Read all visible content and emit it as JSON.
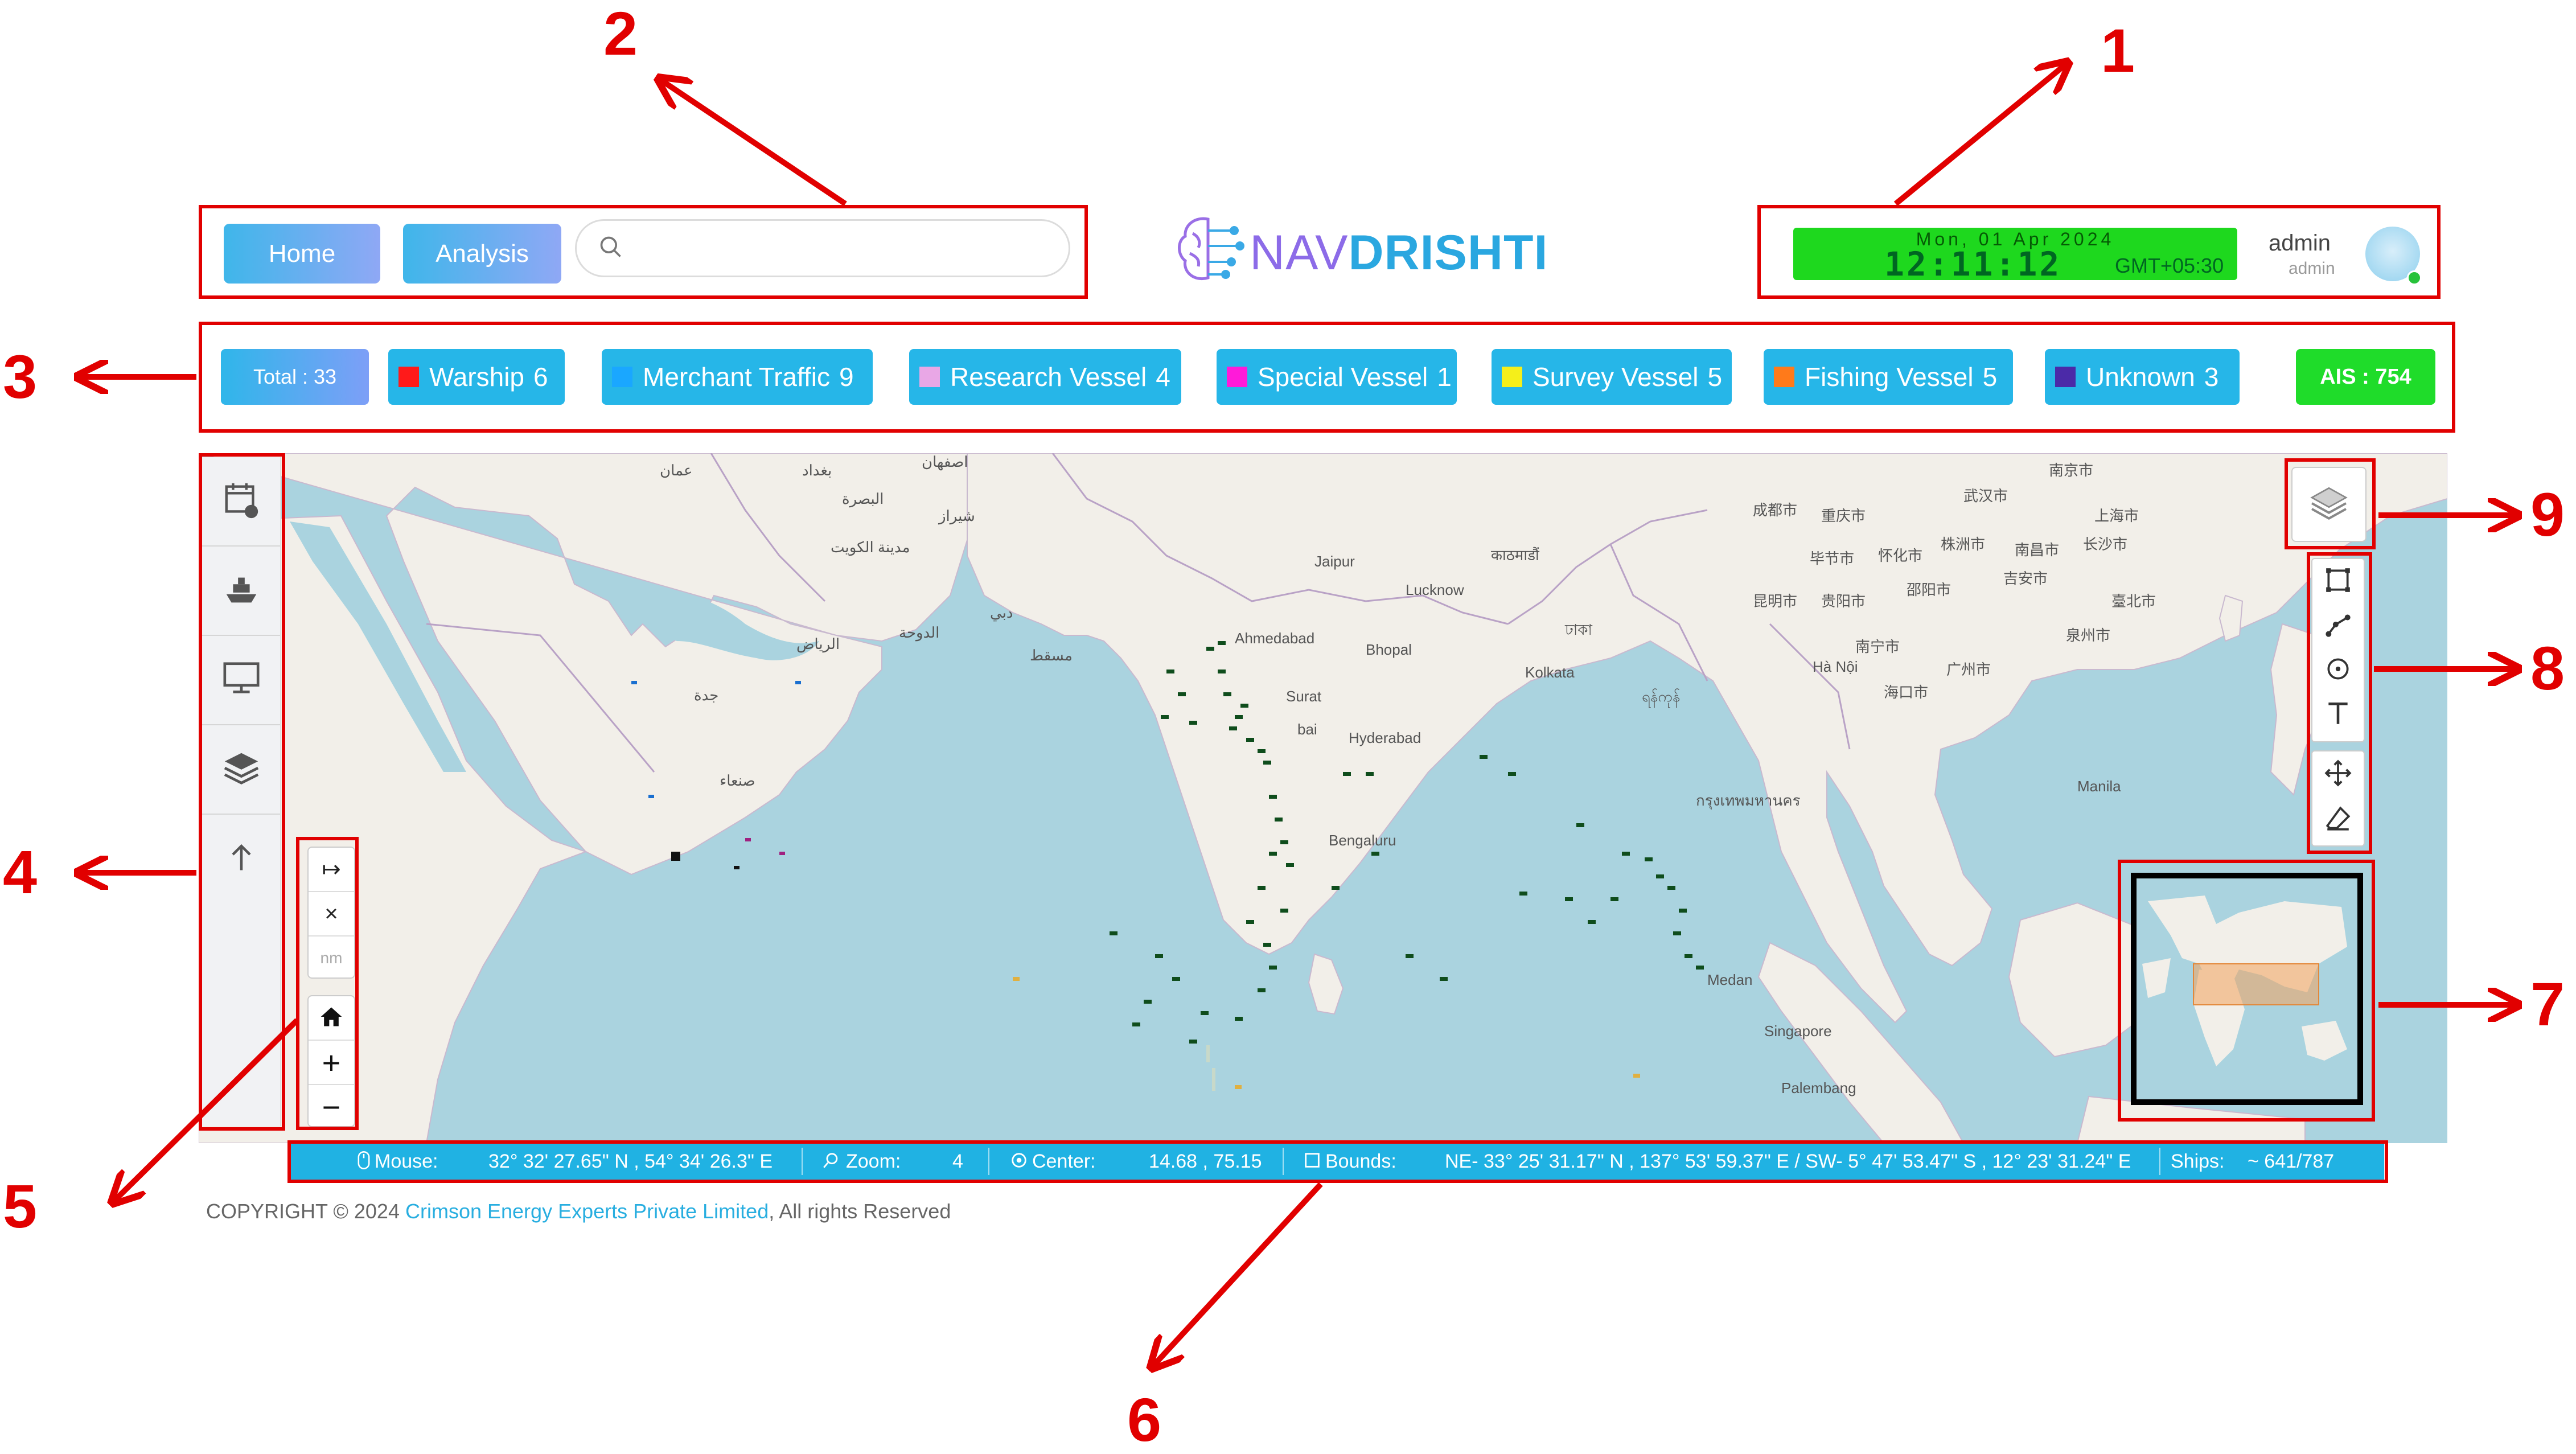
{
  "header": {
    "nav": {
      "home": "Home",
      "analysis": "Analysis"
    },
    "search": {
      "placeholder": "",
      "value": ""
    },
    "logo": {
      "part1": "NAV",
      "part2": "DRISHTI"
    },
    "clock": {
      "date": "Mon, 01 Apr 2024",
      "time": "12:11:12",
      "timezone": "GMT+05:30"
    },
    "user": {
      "name": "admin",
      "role": "admin"
    }
  },
  "filters": {
    "total": "Total : 33",
    "categories": [
      {
        "label": "Warship",
        "count": "6",
        "color": "#ff1a1a"
      },
      {
        "label": "Merchant Traffic",
        "count": "9",
        "color": "#1aa7ff"
      },
      {
        "label": "Research Vessel",
        "count": "4",
        "color": "#e9a7e6"
      },
      {
        "label": "Special Vessel",
        "count": "1",
        "color": "#ff1ad9"
      },
      {
        "label": "Survey Vessel",
        "count": "5",
        "color": "#f5ef1a"
      },
      {
        "label": "Fishing Vessel",
        "count": "5",
        "color": "#ff7a1a"
      },
      {
        "label": "Unknown",
        "count": "3",
        "color": "#4b2aa8"
      }
    ],
    "ais": "AIS : 754"
  },
  "map": {
    "sidebar_icons": [
      "calendar-filter-icon",
      "ship-icon",
      "monitor-icon",
      "layers-icon",
      "arrow-up-icon"
    ],
    "measure": {
      "measure_symbol": "↦",
      "clear_symbol": "×",
      "unit": "nm"
    },
    "zoom": {
      "home_symbol": "⌂",
      "in_symbol": "+",
      "out_symbol": "−"
    },
    "places": {
      "jaipur": "Jaipur",
      "lucknow": "Lucknow",
      "ahmedabad": "Ahmedabad",
      "bhopal": "Bhopal",
      "surat": "Surat",
      "bai": "bai",
      "hyderabad": "Hyderabad",
      "kolkata": "Kolkata",
      "bengaluru": "Bengaluru",
      "hanoi": "Hà Nội",
      "manila": "Manila",
      "medan": "Medan",
      "singapore": "Singapore",
      "palembang": "Palembang",
      "kathmandu": "काठमाडौं",
      "chengdu": "成都市",
      "chongqing": "重庆市",
      "wuhan": "武汉市",
      "shanghai": "上海市",
      "nanjing": "南京市",
      "kunming": "昆明市",
      "guiyang": "贵阳市",
      "changsha": "长沙市",
      "nanchang": "南昌市",
      "nanning": "南宁市",
      "guangzhou": "广州市",
      "haikou": "海口市",
      "taipei": "臺北市",
      "xiamen": "泉州市",
      "jian": "吉安市",
      "shaoyang": "邵阳市",
      "zhuzhou": "株洲市",
      "bijie": "毕节市",
      "huaihua": "怀化市",
      "yangon": "ရန်ကုန်",
      "bangkok": "กรุงเทพมหานคร",
      "dhaka": "ঢাকা",
      "riyadh": "الرياض",
      "doha": "الدوحة",
      "sanaa": "صنعاء",
      "muscat": "مسقط",
      "dubai": "دبي",
      "kuwait": "مدينة الكويت",
      "basra": "البصرة",
      "baghdad": "بغداد",
      "isfahan": "اصفهان",
      "shiraz": "شیراز",
      "jeddah": "جدة",
      "amman": "عمان"
    }
  },
  "status": {
    "mouse_label": "Mouse:",
    "mouse": "32° 32' 27.65\" N , 54° 34' 26.3\" E",
    "zoom_label": "Zoom:",
    "zoom": "4",
    "center_label": "Center:",
    "center": "14.68 , 75.15",
    "bounds_label": "Bounds:",
    "bounds": "NE- 33° 25' 31.17\" N , 137° 53' 59.37\" E / SW- 5° 47' 53.47\" S , 12° 23' 31.24\" E",
    "ships_label": "Ships:",
    "ships": "~ 641/787"
  },
  "footer": {
    "prefix": "COPYRIGHT © 2024 ",
    "company": "Crimson Energy Experts Private Limited",
    "suffix": ", All rights Reserved"
  },
  "annotations": [
    "1",
    "2",
    "3",
    "4",
    "5",
    "6",
    "7",
    "8",
    "9"
  ]
}
